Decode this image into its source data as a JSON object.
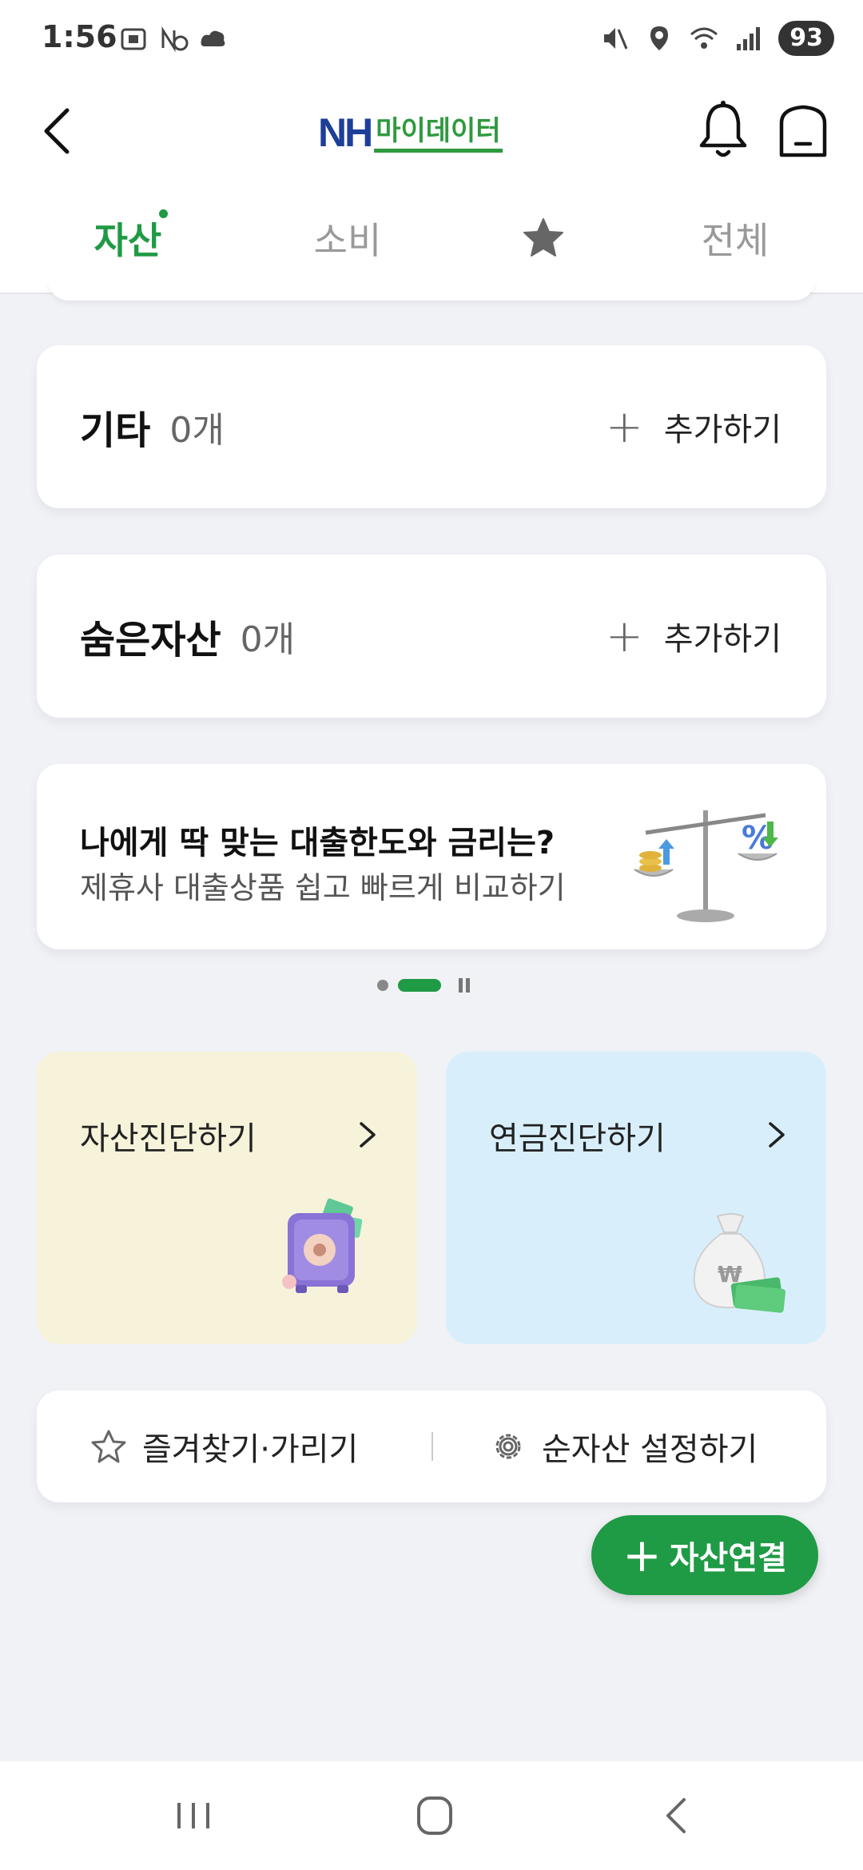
{
  "status_bar": {
    "time": "1:56",
    "battery": "93",
    "left_icons": [
      "screenshot-icon",
      "no-data-icon",
      "cloud-icon"
    ],
    "right_icons": [
      "mute-icon",
      "location-icon",
      "wifi-icon",
      "signal-icon"
    ]
  },
  "header": {
    "logo_nh": "NH",
    "logo_mydata": "마이데이터"
  },
  "tabs": [
    {
      "label": "자산",
      "active": true,
      "has_dot": true
    },
    {
      "label": "소비",
      "active": false
    },
    {
      "icon": "star-icon",
      "active": false
    },
    {
      "label": "전체",
      "active": false
    }
  ],
  "rows": [
    {
      "title": "기타",
      "count": "0개",
      "action": "추가하기"
    },
    {
      "title": "숨은자산",
      "count": "0개",
      "action": "추가하기"
    }
  ],
  "banner": {
    "title": "나에게 딱 맞는 대출한도와 금리는?",
    "subtitle": "제휴사 대출상품 쉽고 빠르게 비교하기",
    "carousel_index": 2,
    "carousel_count": 2
  },
  "tiles": [
    {
      "label": "자산진단하기",
      "icon": "safe-icon"
    },
    {
      "label": "연금진단하기",
      "icon": "money-bag-icon"
    }
  ],
  "utility": {
    "favorites": "즐겨찾기·가리기",
    "net_assets": "순자산 설정하기"
  },
  "fab": {
    "label": "자산연결"
  },
  "colors": {
    "accent": "#1f9a45",
    "logo_blue": "#1d3f99",
    "tile_left_bg": "#f6f3da",
    "tile_right_bg": "#d8effb",
    "page_bg": "#f0f2f6"
  }
}
